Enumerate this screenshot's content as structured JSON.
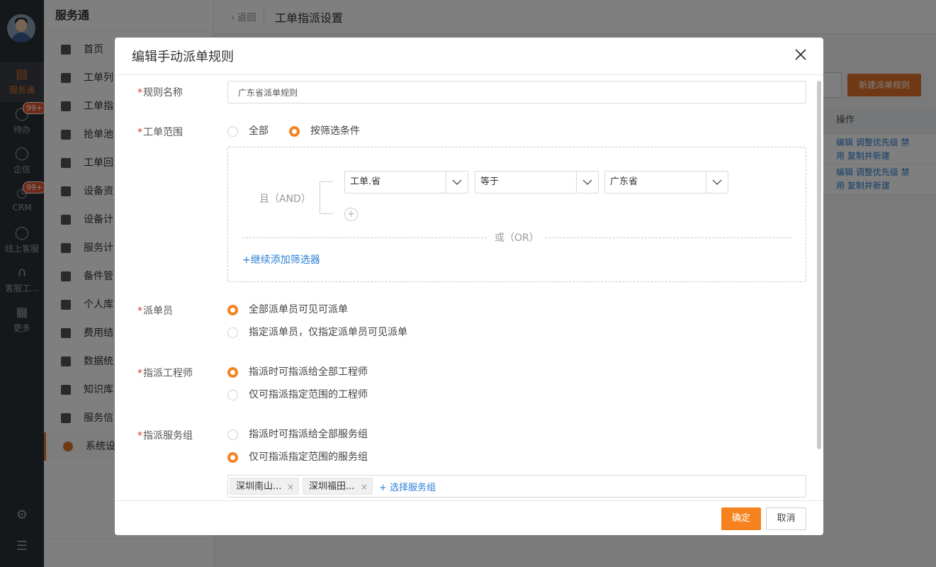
{
  "app": {
    "brand": "服务通",
    "page_title": "工单指派设置",
    "back_label": "返回"
  },
  "rail": {
    "items": [
      {
        "label": "服务通",
        "icon": "clipboard-check-icon",
        "active": true
      },
      {
        "label": "待办",
        "icon": "check-circle-icon",
        "badge": "99+"
      },
      {
        "label": "企信",
        "icon": "chat-bubble-icon"
      },
      {
        "label": "CRM",
        "icon": "clock-icon",
        "badge": "99+"
      },
      {
        "label": "线上客服",
        "icon": "smile-chat-icon"
      },
      {
        "label": "客服工...",
        "icon": "headset-icon"
      },
      {
        "label": "更多",
        "icon": "grid-icon"
      }
    ]
  },
  "sidebar": {
    "items": [
      {
        "label": "首页",
        "icon": "home-icon"
      },
      {
        "label": "工单列",
        "icon": "list-icon"
      },
      {
        "label": "工单指",
        "icon": "assign-icon"
      },
      {
        "label": "抢单池",
        "icon": "pool-icon"
      },
      {
        "label": "工单回",
        "icon": "return-icon"
      },
      {
        "label": "设备资",
        "icon": "device-icon"
      },
      {
        "label": "设备计",
        "icon": "device-plan-icon"
      },
      {
        "label": "服务计",
        "icon": "service-plan-icon"
      },
      {
        "label": "备件管",
        "icon": "parts-icon"
      },
      {
        "label": "个人库",
        "icon": "personal-store-icon"
      },
      {
        "label": "费用结",
        "icon": "fee-icon"
      },
      {
        "label": "数据统",
        "icon": "chart-icon"
      },
      {
        "label": "知识库",
        "icon": "book-icon"
      },
      {
        "label": "服务信",
        "icon": "doc-icon"
      },
      {
        "label": "系统设",
        "icon": "settings-icon",
        "active": true
      }
    ]
  },
  "background_page": {
    "new_rule_button": "新建派单规则",
    "table_header": "操作",
    "rows": [
      {
        "line1": "编辑  调整优先级  禁",
        "line2": "用  复制并新建"
      },
      {
        "line1": "编辑  调整优先级  禁",
        "line2": "用  复制并新建"
      }
    ]
  },
  "modal": {
    "title": "编辑手动派单规则",
    "required_mark": "*",
    "rule_name": {
      "label": "规则名称",
      "value": "广东省派单规则"
    },
    "scope": {
      "label": "工单范围",
      "options": [
        "全部",
        "按筛选条件"
      ],
      "selected": 1,
      "filter": {
        "and_label": "且（AND）",
        "conditions": [
          {
            "field": "工单.省",
            "operator": "等于",
            "value": "广东省"
          }
        ],
        "or_label": "或（OR）",
        "add_filter": "+继续添加筛选器",
        "add_condition": "+"
      }
    },
    "dispatcher": {
      "label": "派单员",
      "options": [
        "全部派单员可见可派单",
        "指定派单员，仅指定派单员可见派单"
      ],
      "selected": 0
    },
    "engineer": {
      "label": "指派工程师",
      "options": [
        "指派时可指派给全部工程师",
        "仅可指派指定范围的工程师"
      ],
      "selected": 0
    },
    "service_group": {
      "label": "指派服务组",
      "options": [
        "指派时可指派给全部服务组",
        "仅可指派指定范围的服务组"
      ],
      "selected": 1,
      "tags": [
        "深圳南山...",
        "深圳福田..."
      ],
      "tag_remove": "×",
      "pick_label": "+ 选择服务组"
    },
    "footer": {
      "confirm": "确定",
      "cancel": "取消"
    }
  },
  "colors": {
    "accent": "#f5821f",
    "link": "#2a7fd4",
    "required": "#e0332b"
  }
}
